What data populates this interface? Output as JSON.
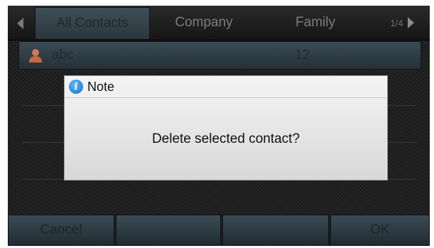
{
  "tabs": [
    {
      "label": "All Contacts",
      "active": true
    },
    {
      "label": "Company",
      "active": false
    },
    {
      "label": "Family",
      "active": false
    }
  ],
  "page_indicator": "1/4",
  "contact": {
    "name": "abc",
    "number": "12"
  },
  "dialog": {
    "title": "Note",
    "message": "Delete selected contact?"
  },
  "softkeys": [
    "Cancel",
    "",
    "",
    "OK"
  ]
}
